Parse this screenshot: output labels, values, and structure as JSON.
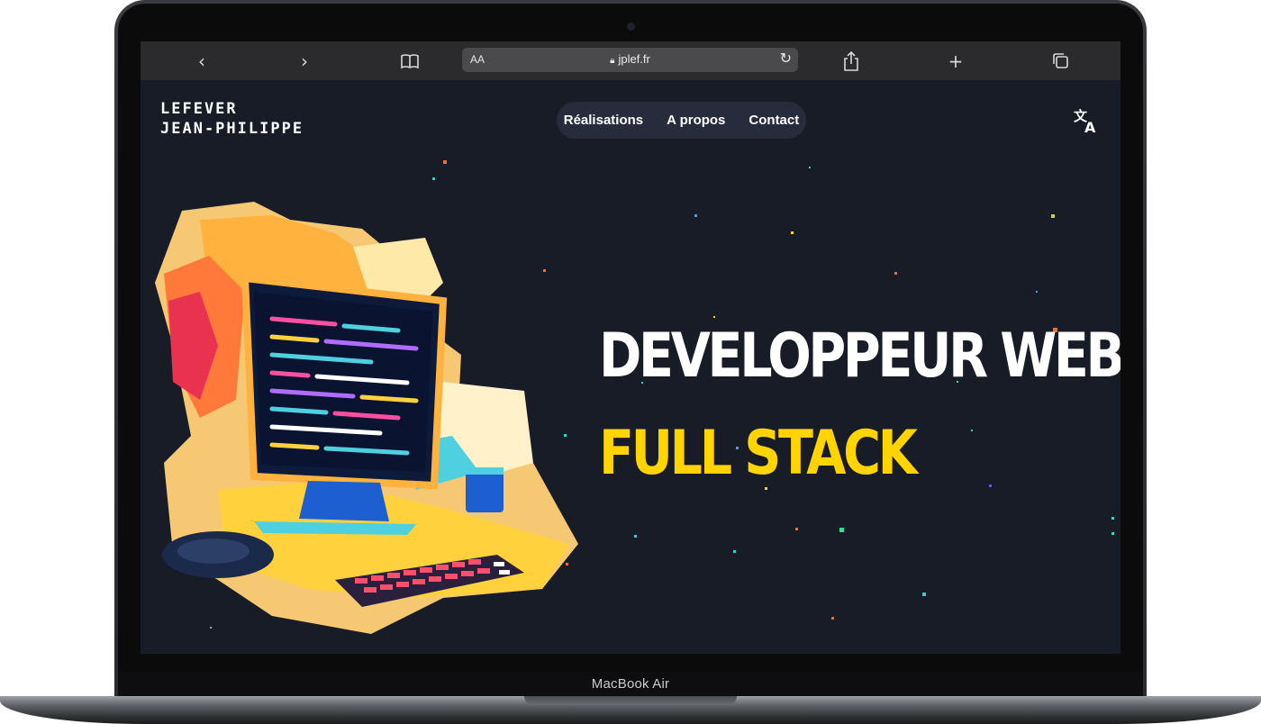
{
  "browser": {
    "address": "jplef.fr",
    "reader_label": "AA",
    "icons": [
      "back-icon",
      "forward-icon",
      "bookmarks-icon",
      "lock-icon",
      "reload-icon",
      "share-icon",
      "new-tab-icon",
      "tabs-icon"
    ]
  },
  "site": {
    "brand_line1": "LEFEVER",
    "brand_line2": "JEAN-PHILIPPE",
    "nav": [
      "Réalisations",
      "A propos",
      "Contact"
    ],
    "translate_icon": "translate-icon",
    "hero_title": "DEVELOPPEUR WEB",
    "hero_subtitle": "FULL STACK",
    "colors": {
      "background": "#181c27",
      "accent": "#ffd400",
      "text": "#ffffff"
    }
  },
  "device": {
    "label": "MacBook Air"
  }
}
